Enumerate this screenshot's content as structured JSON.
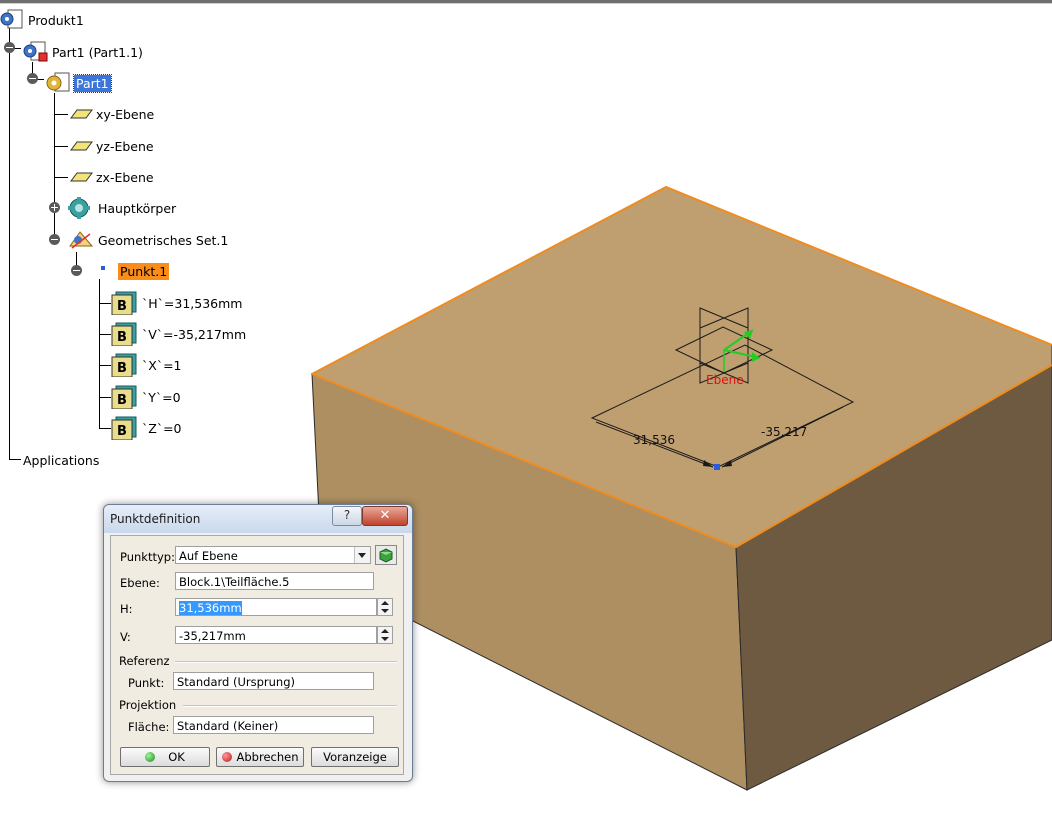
{
  "tree": {
    "root": "Produkt1",
    "part_instance": "Part1 (Part1.1)",
    "part": "Part1",
    "planes": [
      "xy-Ebene",
      "yz-Ebene",
      "zx-Ebene"
    ],
    "body": "Hauptkörper",
    "geoset": "Geometrisches Set.1",
    "point": "Punkt.1",
    "params": [
      "`H`=31,536mm",
      "`V`=-35,217mm",
      "`X`=1",
      "`Y`=0",
      "`Z`=0"
    ],
    "applications": "Applications"
  },
  "viewport": {
    "dim_h": "31,536",
    "dim_v": "-35,217",
    "plane_label": "Ebene",
    "colors": {
      "top_face": "#bf9f70",
      "left_face": "#ad8f62",
      "right_face": "#6d5a41",
      "edge_highlight": "#f08c1e"
    }
  },
  "dialog": {
    "title": "Punktdefinition",
    "help_label": "?",
    "close_label": "✕",
    "type_label": "Punkttyp:",
    "type_value": "Auf Ebene",
    "plane_label": "Ebene:",
    "plane_value": "Block.1\\Teilfläche.5",
    "h_label": "H:",
    "h_value": "31,536mm",
    "v_label": "V:",
    "v_value": "-35,217mm",
    "reference_section": "Referenz",
    "point_label": "Punkt:",
    "point_value": "Standard (Ursprung)",
    "projection_section": "Projektion",
    "surface_label": "Fläche:",
    "surface_value": "Standard (Keiner)",
    "ok_label": "OK",
    "cancel_label": "Abbrechen",
    "preview_label": "Voranzeige"
  }
}
